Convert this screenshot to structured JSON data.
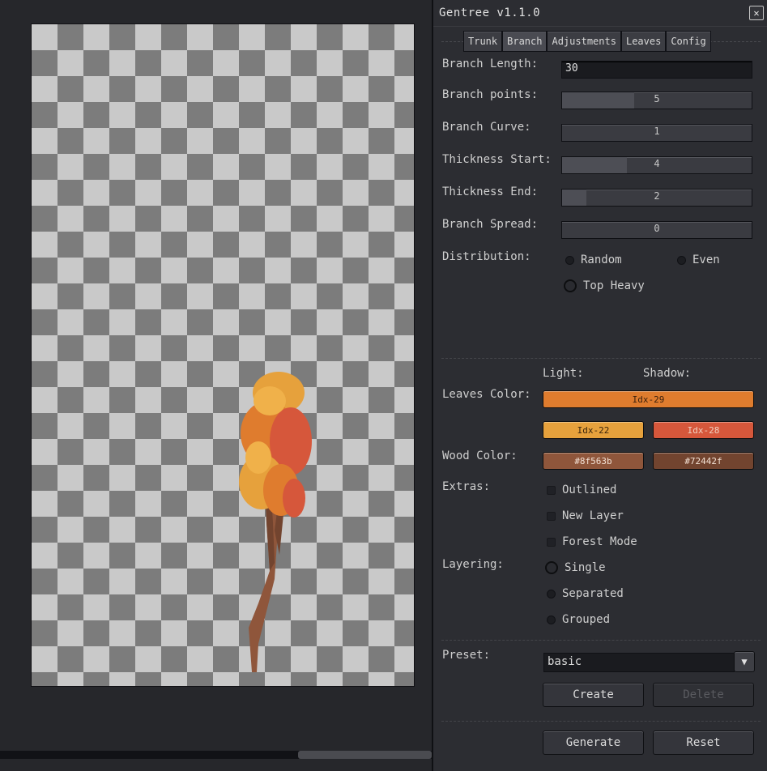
{
  "dialog": {
    "title": "Gentree v1.1.0",
    "tabs": [
      "Trunk",
      "Branch",
      "Adjustments",
      "Leaves",
      "Config"
    ],
    "active_tab": "Branch",
    "branch_length": {
      "label": "Branch Length:",
      "value": "30"
    },
    "branch_points": {
      "label": "Branch points:",
      "value": "5",
      "fill_fraction": 0.38
    },
    "branch_curve": {
      "label": "Branch Curve:",
      "value": "1",
      "fill_fraction": 0
    },
    "thickness_start": {
      "label": "Thickness Start:",
      "value": "4",
      "fill_fraction": 0.34
    },
    "thickness_end": {
      "label": "Thickness End:",
      "value": "2",
      "fill_fraction": 0.13
    },
    "branch_spread": {
      "label": "Branch Spread:",
      "value": "0",
      "fill_fraction": 0
    },
    "distribution": {
      "label": "Distribution:",
      "options": [
        "Random",
        "Even",
        "Top Heavy"
      ],
      "selected": "Top Heavy"
    },
    "colors": {
      "light_label": "Light:",
      "shadow_label": "Shadow:",
      "leaves_label": "Leaves Color:",
      "wood_label": "Wood Color:",
      "leaves_main": {
        "text": "Idx-29",
        "color": "#df7c2e"
      },
      "leaves_light": {
        "text": "Idx-22",
        "color": "#e6a13c"
      },
      "leaves_shadow": {
        "text": "Idx-28",
        "color": "#d6573b"
      },
      "wood_light": {
        "text": "#8f563b",
        "color": "#8f563b"
      },
      "wood_shadow": {
        "text": "#72442f",
        "color": "#72442f"
      }
    },
    "extras": {
      "label": "Extras:",
      "options": [
        "Outlined",
        "New Layer",
        "Forest Mode"
      ]
    },
    "layering": {
      "label": "Layering:",
      "options": [
        "Single",
        "Separated",
        "Grouped"
      ],
      "selected": "Single"
    },
    "preset": {
      "label": "Preset:",
      "value": "basic"
    },
    "buttons": {
      "create": "Create",
      "delete": "Delete",
      "generate": "Generate",
      "reset": "Reset"
    }
  }
}
